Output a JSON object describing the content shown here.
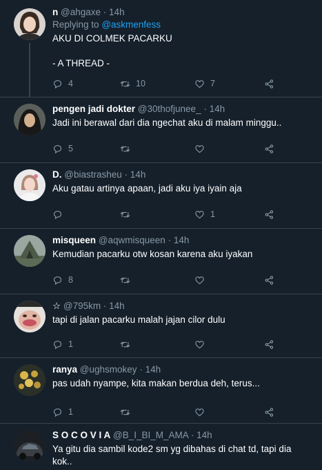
{
  "tweets": [
    {
      "name": "n",
      "handle": "@ahgaxe",
      "time": "14h",
      "replying_prefix": "Replying to",
      "replying_to": "@askmenfess",
      "lines": [
        "AKU DI COLMEK PACARKU",
        "",
        "- A THREAD -"
      ],
      "replies": "4",
      "retweets": "10",
      "likes": "7",
      "avatar": "photo-woman-light"
    },
    {
      "name": "pengen jadi dokter",
      "handle": "@30thofjunee_",
      "time": "14h",
      "lines": [
        "Jadi ini berawal dari dia ngechat aku di malam minggu.."
      ],
      "replies": "5",
      "retweets": "",
      "likes": "",
      "avatar": "photo-hijab"
    },
    {
      "name": "D.",
      "handle": "@biastrasheu",
      "time": "14h",
      "lines": [
        "Aku gatau artinya apaan, jadi aku iya iyain aja"
      ],
      "replies": "",
      "retweets": "",
      "likes": "1",
      "avatar": "photo-girl-white"
    },
    {
      "name": "misqueen",
      "handle": "@aqwmisqueen",
      "time": "14h",
      "lines": [
        "Kemudian pacarku otw kosan karena aku iyakan"
      ],
      "replies": "8",
      "retweets": "",
      "likes": "",
      "avatar": "photo-tent"
    },
    {
      "name": "☆",
      "handle": "@795km",
      "time": "14h",
      "lines": [
        "tapi di jalan pacarku malah jajan cilor dulu"
      ],
      "replies": "1",
      "retweets": "",
      "likes": "",
      "avatar": "photo-meme-face"
    },
    {
      "name": "ranya",
      "handle": "@ughsmokey",
      "time": "14h",
      "lines": [
        "pas udah nyampe, kita makan berdua deh, terus..."
      ],
      "replies": "1",
      "retweets": "",
      "likes": "",
      "avatar": "photo-flowers"
    },
    {
      "name": "S O C O V I A",
      "handle": "@B_I_BI_M_AMA",
      "time": "14h",
      "lines": [
        "Ya gitu dia sambil kode2 sm yg dibahas di chat td, tapi dia",
        "kok.."
      ],
      "replies": "",
      "retweets": "",
      "likes": "",
      "avatar": "photo-car"
    }
  ],
  "separator": "·",
  "icons": {
    "reply": "reply-icon",
    "retweet": "retweet-icon",
    "like": "heart-icon",
    "share": "share-icon"
  },
  "colors": {
    "background": "#15202b",
    "divider": "#38444d",
    "muted": "#8899a6",
    "link": "#1da1f2"
  }
}
